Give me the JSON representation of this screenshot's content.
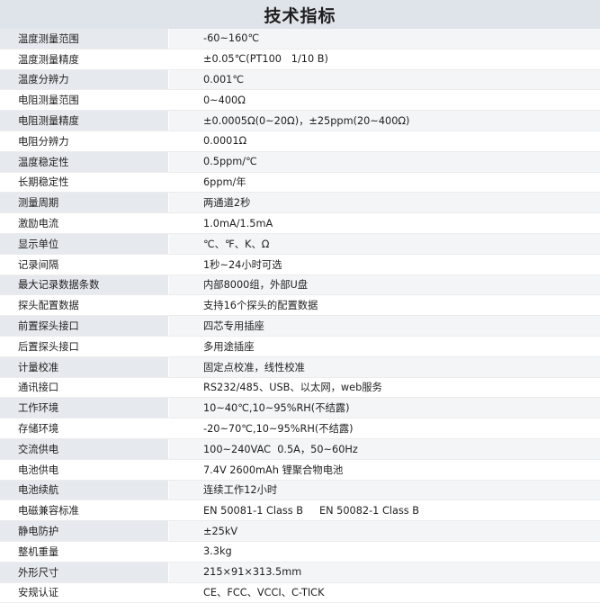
{
  "title": "技术指标",
  "rows": [
    {
      "label": "温度测量范围",
      "value": "-60~160℃"
    },
    {
      "label": "温度测量精度",
      "value": "±0.05℃(PT100   1/10 B)"
    },
    {
      "label": "温度分辨力",
      "value": "0.001℃"
    },
    {
      "label": "电阻测量范围",
      "value": "0~400Ω"
    },
    {
      "label": "电阻测量精度",
      "value": "±0.0005Ω(0~20Ω)，±25ppm(20~400Ω)"
    },
    {
      "label": "电阻分辨力",
      "value": "0.0001Ω"
    },
    {
      "label": "温度稳定性",
      "value": "0.5ppm/℃"
    },
    {
      "label": "长期稳定性",
      "value": "6ppm/年"
    },
    {
      "label": "测量周期",
      "value": "两通道2秒"
    },
    {
      "label": "激励电流",
      "value": "1.0mA/1.5mA"
    },
    {
      "label": "显示单位",
      "value": "℃、℉、K、Ω"
    },
    {
      "label": "记录间隔",
      "value": "1秒~24小时可选"
    },
    {
      "label": "最大记录数据条数",
      "value": "内部8000组，外部U盘"
    },
    {
      "label": "探头配置数据",
      "value": "支持16个探头的配置数据"
    },
    {
      "label": "前置探头接口",
      "value": "四芯专用插座"
    },
    {
      "label": "后置探头接口",
      "value": "多用途插座"
    },
    {
      "label": "计量校准",
      "value": "固定点校准，线性校准"
    },
    {
      "label": "通讯接口",
      "value": "RS232/485、USB、以太网，web服务"
    },
    {
      "label": "工作环境",
      "value": "10~40℃,10~95%RH(不结露)"
    },
    {
      "label": "存储环境",
      "value": "-20~70℃,10~95%RH(不结露)"
    },
    {
      "label": "交流供电",
      "value": "100~240VAC  0.5A，50~60Hz"
    },
    {
      "label": "电池供电",
      "value": "7.4V 2600mAh 锂聚合物电池"
    },
    {
      "label": "电池续航",
      "value": "连续工作12小时"
    },
    {
      "label": "电磁兼容标准",
      "value": "EN 50081-1 Class B     EN 50082-1 Class B"
    },
    {
      "label": "静电防护",
      "value": "±25kV"
    },
    {
      "label": "整机重量",
      "value": "3.3kg"
    },
    {
      "label": "外形尺寸",
      "value": "215×91×313.5mm"
    },
    {
      "label": "安规认证",
      "value": "CE、FCC、VCCI、C-TICK"
    }
  ]
}
